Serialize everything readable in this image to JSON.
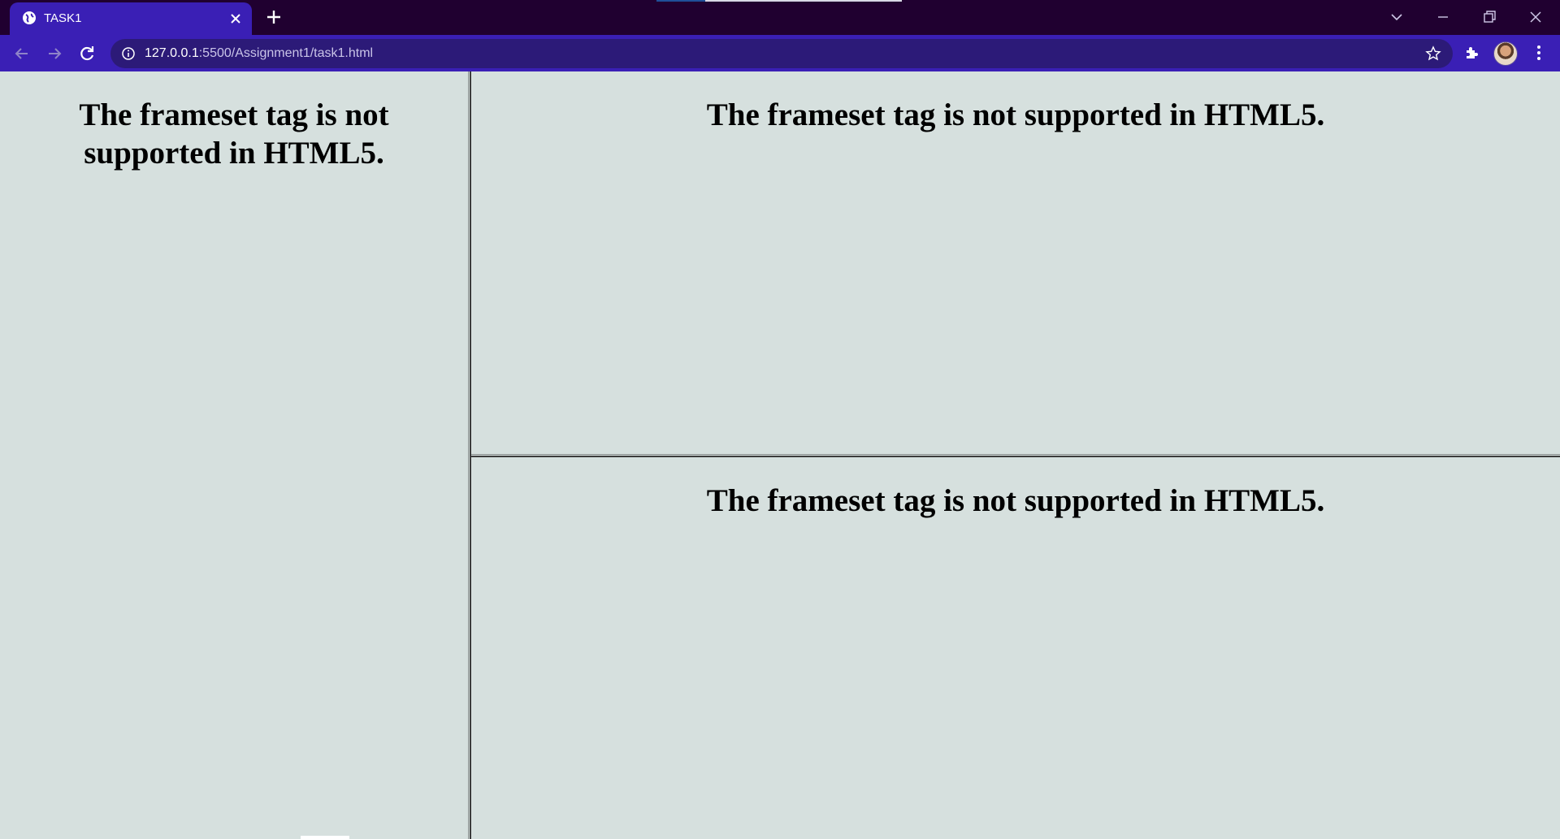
{
  "browser": {
    "tab": {
      "title": "TASK1",
      "favicon": "globe-icon"
    },
    "address_bar": {
      "host": "127.0.0.1",
      "port_path": ":5500/Assignment1/task1.html"
    },
    "colors": {
      "titlebar": "#200030",
      "toolbar": "#3a1fb5",
      "omnibox": "#2c1a78",
      "page_background": "#d6e0de"
    }
  },
  "frames": {
    "left": {
      "heading": "The frameset tag is not supported in HTML5."
    },
    "right_top": {
      "heading": "The frameset tag is not supported in HTML5."
    },
    "right_bottom": {
      "heading": "The frameset tag is not supported in HTML5."
    }
  }
}
